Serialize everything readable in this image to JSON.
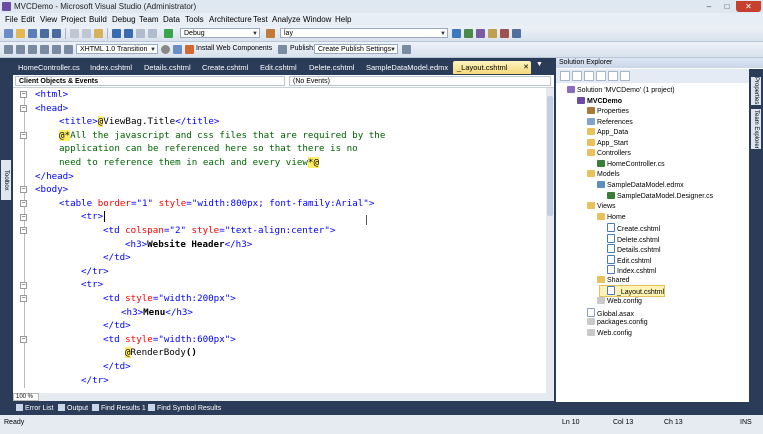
{
  "window": {
    "title": "MVCDemo - Microsoft Visual Studio (Administrator)",
    "buttons": {
      "minimize": "–",
      "maximize": "□",
      "close": "✕"
    }
  },
  "menu": [
    "File",
    "Edit",
    "View",
    "Project",
    "Build",
    "Debug",
    "Team",
    "Data",
    "Tools",
    "Architecture",
    "Test",
    "Analyze",
    "Window",
    "Help"
  ],
  "toolbar1": {
    "config": "Debug",
    "search": "lay"
  },
  "toolbar2": {
    "doctype": "XHTML 1.0 Transition",
    "install": "Install Web Components",
    "publish_label": "Publish:",
    "publish_value": "Create Publish Settings"
  },
  "doc_tabs": [
    {
      "label": "HomeController.cs",
      "active": false
    },
    {
      "label": "Index.cshtml",
      "active": false
    },
    {
      "label": "Details.cshtml",
      "active": false
    },
    {
      "label": "Create.cshtml",
      "active": false
    },
    {
      "label": "Edit.cshtml",
      "active": false
    },
    {
      "label": "Delete.cshtml",
      "active": false
    },
    {
      "label": "SampleDataModel.edmx",
      "active": false
    },
    {
      "label": "_Layout.cshtml",
      "active": true
    }
  ],
  "nav": {
    "left": "Client Objects & Events",
    "right": "(No Events)"
  },
  "code": {
    "l1": "<html>",
    "l2": "<head>",
    "l3a": "<title>",
    "l3b": "@",
    "l3c": "ViewBag.Title",
    "l3d": "</title>",
    "l4a": "@*",
    "l4b": "All the javascript and css files that are required by the",
    "l5": "application can be referenced here so that there is no",
    "l6a": "need to reference them in each and every view",
    "l6b": "*@",
    "l7": "</head>",
    "l8": "<body>",
    "l9a": "<table",
    "l9b": " border",
    "l9c": "=\"1\"",
    "l9d": " style",
    "l9e": "=\"width:800px; font-family:Arial\"",
    "l9f": ">",
    "l10": "<tr>",
    "l11a": "<td",
    "l11b": " colspan",
    "l11c": "=\"2\"",
    "l11d": " style",
    "l11e": "=\"text-align:center\"",
    "l11f": ">",
    "l12a": "<h3>",
    "l12b": "Website Header",
    "l12c": "</h3>",
    "l13": "</td>",
    "l14": "</tr>",
    "l15": "<tr>",
    "l16a": "<td",
    "l16b": " style",
    "l16c": "=\"width:200px\"",
    "l16d": ">",
    "l17a": "<h3>",
    "l17b": "Menu",
    "l17c": "</h3>",
    "l18": "</td>",
    "l19a": "<td",
    "l19b": " style",
    "l19c": "=\"width:600px\"",
    "l19d": ">",
    "l20a": "@",
    "l20b": "RenderBody",
    "l20c": "()",
    "l21": "</td>",
    "l22": "</tr>"
  },
  "zoom": "100 %",
  "solution_explorer": {
    "title": "Solution Explorer",
    "nodes": [
      {
        "label": "Solution 'MVCDemo' (1 project)",
        "type": "sol",
        "indent": 0
      },
      {
        "label": "MVCDemo",
        "type": "proj",
        "indent": 1,
        "bold": true
      },
      {
        "label": "Properties",
        "type": "gear",
        "indent": 2
      },
      {
        "label": "References",
        "type": "ref",
        "indent": 2
      },
      {
        "label": "App_Data",
        "type": "folder",
        "indent": 2
      },
      {
        "label": "App_Start",
        "type": "folder",
        "indent": 2
      },
      {
        "label": "Controllers",
        "type": "folder",
        "indent": 2
      },
      {
        "label": "HomeController.cs",
        "type": "cs",
        "indent": 3
      },
      {
        "label": "Models",
        "type": "folder",
        "indent": 2
      },
      {
        "label": "SampleDataModel.edmx",
        "type": "edmx",
        "indent": 3
      },
      {
        "label": "SampleDataModel.Designer.cs",
        "type": "cs",
        "indent": 4
      },
      {
        "label": "Views",
        "type": "folder",
        "indent": 2
      },
      {
        "label": "Home",
        "type": "folder",
        "indent": 3
      },
      {
        "label": "Create.cshtml",
        "type": "html",
        "indent": 4
      },
      {
        "label": "Delete.cshtml",
        "type": "html",
        "indent": 4
      },
      {
        "label": "Details.cshtml",
        "type": "html",
        "indent": 4
      },
      {
        "label": "Edit.cshtml",
        "type": "html",
        "indent": 4
      },
      {
        "label": "Index.cshtml",
        "type": "html",
        "indent": 4
      },
      {
        "label": "Shared",
        "type": "folder",
        "indent": 3
      },
      {
        "label": "_Layout.cshtml",
        "type": "html",
        "indent": 4,
        "selected": true
      },
      {
        "label": "Web.config",
        "type": "cfg",
        "indent": 3
      },
      {
        "label": "Global.asax",
        "type": "file",
        "indent": 2
      },
      {
        "label": "packages.config",
        "type": "cfg",
        "indent": 2
      },
      {
        "label": "Web.config",
        "type": "cfg",
        "indent": 2
      }
    ]
  },
  "side_tabs": {
    "toolbox": "Toolbox",
    "right1": "Properties",
    "right2": "Team Explorer"
  },
  "bottom_tabs": [
    "Error List",
    "Output",
    "Find Results 1",
    "Find Symbol Results"
  ],
  "status": {
    "left": "Ready",
    "ln": "Ln 10",
    "col": "Col 13",
    "ch": "Ch 13",
    "ins": "INS"
  }
}
